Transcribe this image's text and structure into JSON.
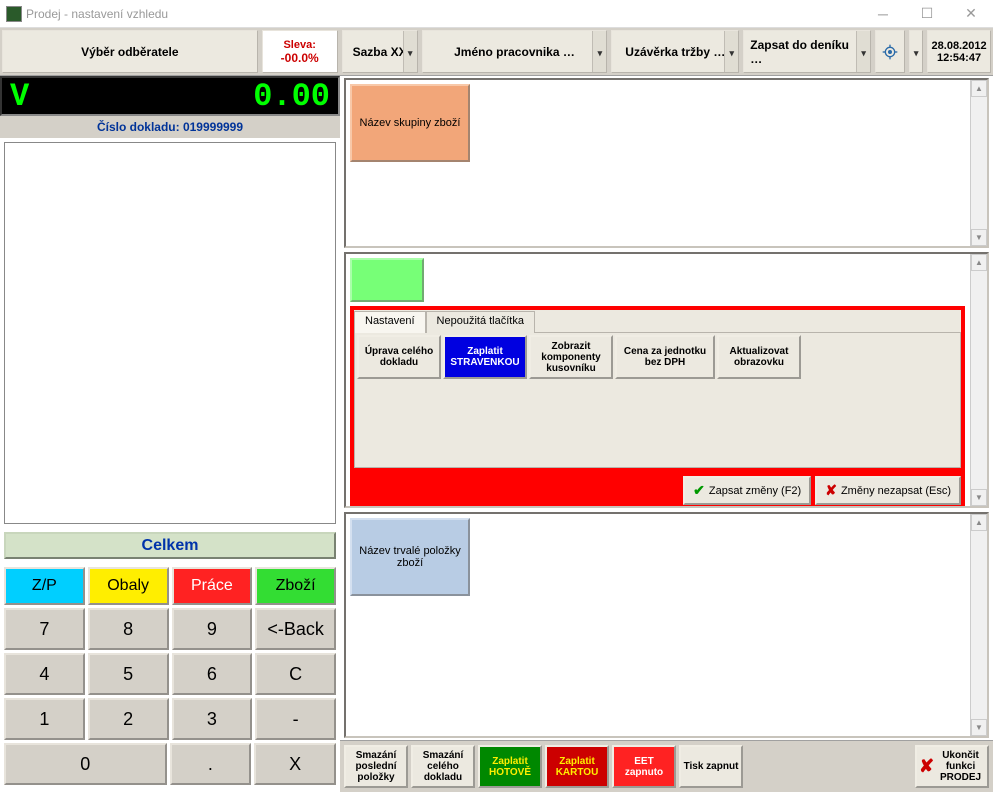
{
  "window": {
    "title": "Prodej - nastavení vzhledu"
  },
  "toolbar": {
    "customer": "Výběr odběratele",
    "sleva_label": "Sleva:",
    "sleva_value": "-00.0%",
    "sazba": "Sazba XX",
    "jmeno": "Jméno pracovnika …",
    "uzaverka": "Uzávěrka tržby …",
    "zapsat": "Zapsat do deníku …",
    "date": "28.08.2012",
    "time": "12:54:47"
  },
  "display": {
    "currency": "V",
    "value": "0.00"
  },
  "document_number": "Číslo dokladu: 019999999",
  "celkem_label": "Celkem",
  "keypad": {
    "cat_zp": "Z/P",
    "cat_obaly": "Obaly",
    "cat_prace": "Práce",
    "cat_zbozi": "Zboží",
    "k7": "7",
    "k8": "8",
    "k9": "9",
    "kback": "<-Back",
    "k4": "4",
    "k5": "5",
    "k6": "6",
    "kc": "C",
    "k1": "1",
    "k2": "2",
    "k3": "3",
    "kminus": "-",
    "k0": "0",
    "kdot": ".",
    "kx": "X"
  },
  "group_tile": "Název skupiny zboží",
  "settings": {
    "tab_settings": "Nastavení",
    "tab_unused": "Nepoužitá tlačítka",
    "opt_edit": "Úprava celého dokladu",
    "opt_voucher": "Zaplatit STRAVENKOU",
    "opt_bom": "Zobrazit komponenty kusovníku",
    "opt_unitprice": "Cena za jednotku bez DPH",
    "opt_refresh": "Aktualizovat obrazovku",
    "btn_save": "Zapsat změny (F2)",
    "btn_cancel": "Změny nezapsat (Esc)"
  },
  "permanent_tile": "Název trvalé položky zboží",
  "bottombar": {
    "del_last": "Smazání poslední položky",
    "del_all": "Smazání celého dokladu",
    "pay_cash": "Zaplatit HOTOVĚ",
    "pay_card": "Zaplatit KARTOU",
    "eet": "EET zapnuto",
    "print": "Tisk zapnut",
    "exit": "Ukončit funkci PRODEJ"
  }
}
